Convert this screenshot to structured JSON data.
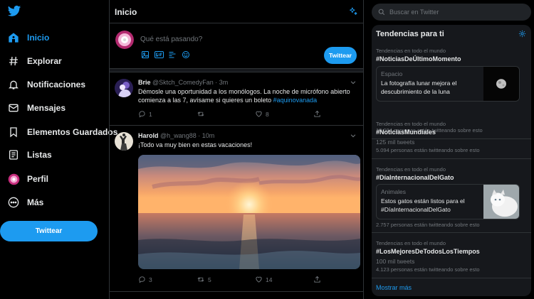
{
  "nav": {
    "items": [
      {
        "label": "Inicio",
        "icon": "home-icon",
        "active": true
      },
      {
        "label": "Explorar",
        "icon": "hashtag-icon"
      },
      {
        "label": "Notificaciones",
        "icon": "bell-icon"
      },
      {
        "label": "Mensajes",
        "icon": "mail-icon"
      },
      {
        "label": "Elementos Guardados",
        "icon": "bookmark-icon"
      },
      {
        "label": "Listas",
        "icon": "list-icon"
      },
      {
        "label": "Perfil",
        "icon": "profile-avatar-icon"
      },
      {
        "label": "Más",
        "icon": "more-icon"
      }
    ],
    "tweet_button": "Twittear"
  },
  "main": {
    "title": "Inicio",
    "composer": {
      "placeholder": "Qué está pasando?",
      "tweet_button": "Twittear"
    },
    "tweets": [
      {
        "name": "Brie",
        "handle": "@Sktch_ComedyFan",
        "time": "3m",
        "text": "Démosle una oportunidad a los monólogos. La noche de micrófono abierto comienza a las 7, avísame si quieres un boleto ",
        "hashtag": "#aquinovanada",
        "replies": "1",
        "retweets": "",
        "likes": "8"
      },
      {
        "name": "Harold",
        "handle": "@h_wang88",
        "time": "10m",
        "text": "¡Todo va muy bien en estas vacaciones!",
        "replies": "3",
        "retweets": "5",
        "likes": "14"
      }
    ]
  },
  "side": {
    "search_placeholder": "Buscar en Twitter",
    "trends_title": "Tendencias para ti",
    "trends": [
      {
        "context": "Tendencias en todo el mundo",
        "tag": "#NoticiasDeÚltimoMomento",
        "card": {
          "topic": "Espacio",
          "text": "La fotografía lunar mejora el descubrimiento de la luna"
        },
        "tweeting": "10.094 personas están twitteando sobre esto"
      },
      {
        "context": "Tendencias en todo el mundo",
        "tag": "#NoticiasMundiales",
        "count": "125 mil tweets",
        "tweeting": "5.094 personas están twitteando sobre esto"
      },
      {
        "context": "Tendencias en todo el mundo",
        "tag": "#DíaInternacionalDelGato",
        "card": {
          "topic": "Animales",
          "text": "Estos gatos están listos para el #DíaInternacionalDelGato"
        },
        "tweeting": "2.757 personas están twitteando sobre esto"
      },
      {
        "context": "Tendencias en todo el mundo",
        "tag": "#LosMejoresDeTodosLosTiempos",
        "count": "100 mil tweets",
        "tweeting": "4.123 personas están twitteando sobre esto"
      }
    ],
    "show_more": "Mostrar más"
  },
  "colors": {
    "accent": "#1d9bf0",
    "background": "#000000",
    "panel": "#16181c",
    "border": "#2f3336",
    "muted_text": "#71767b"
  }
}
